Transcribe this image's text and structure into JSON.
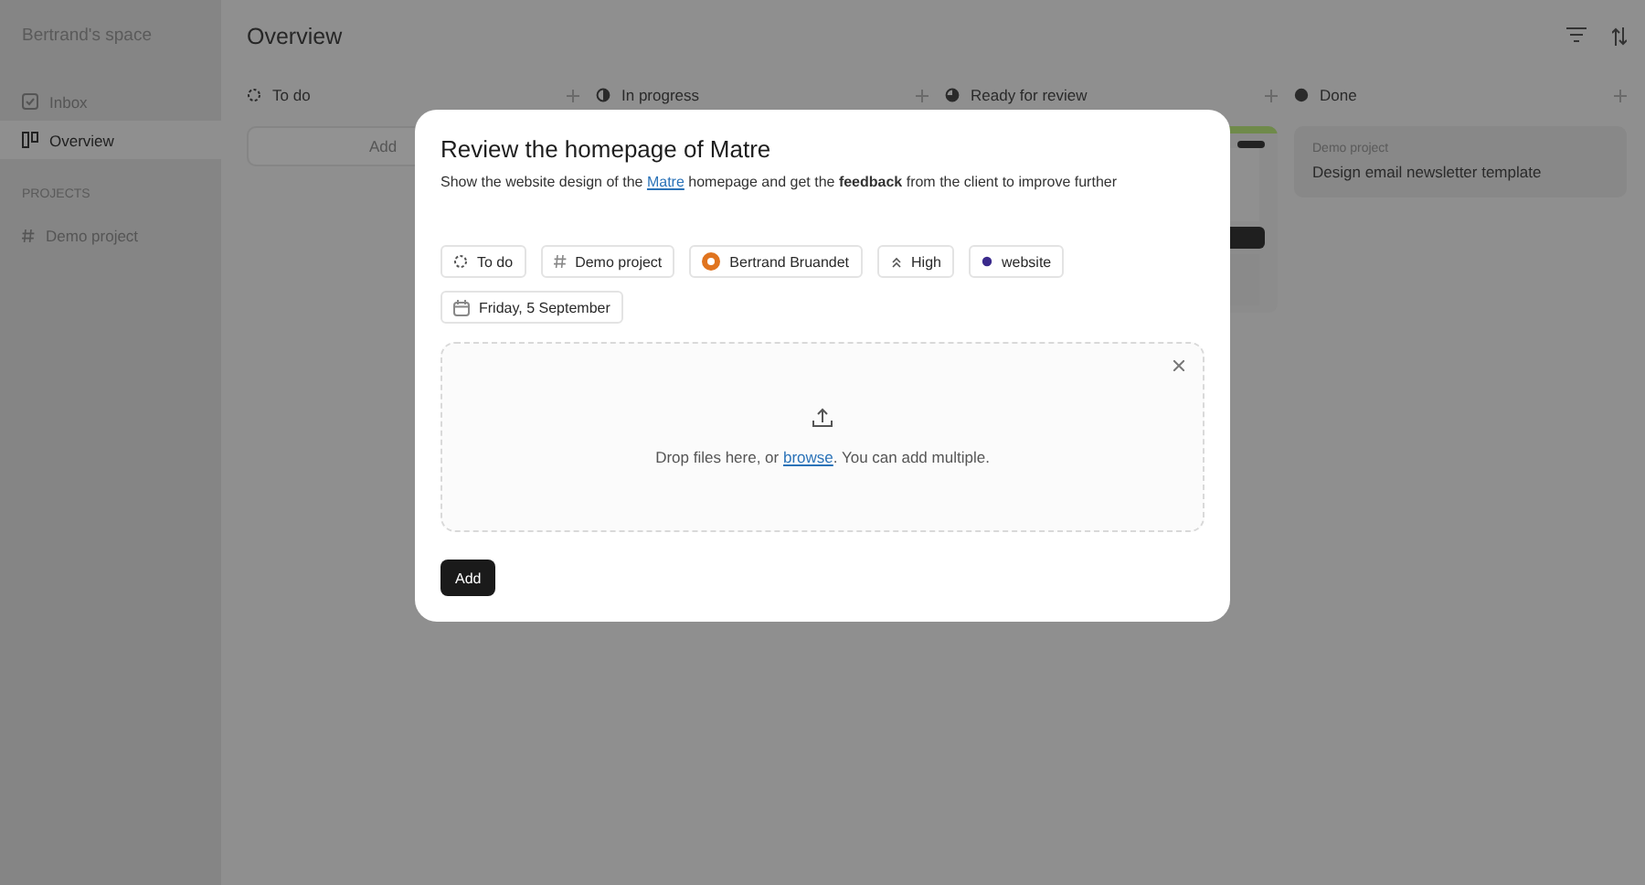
{
  "sidebar": {
    "workspace": "Bertrand's space",
    "items": [
      {
        "label": "Inbox",
        "selected": false
      },
      {
        "label": "Overview",
        "selected": true
      }
    ],
    "section": "PROJECTS",
    "projects": [
      {
        "label": "Demo project"
      }
    ]
  },
  "header": {
    "title": "Overview"
  },
  "columns": [
    {
      "title": "To do",
      "kind": "todo",
      "add_button": "Add"
    },
    {
      "title": "In progress",
      "kind": "progress"
    },
    {
      "title": "Ready for review",
      "kind": "review"
    },
    {
      "title": "Done",
      "kind": "done",
      "cards": [
        {
          "kind": "text",
          "project": "Demo project",
          "title": "Design email newsletter template"
        }
      ]
    }
  ],
  "modal": {
    "title": "Review the homepage of Matre",
    "description": {
      "before": "Show the website design of the ",
      "link": "Matre",
      "after": " homepage and get the **feedback** from the client to improve further"
    },
    "chips": [
      {
        "kind": "status",
        "label": "To do"
      },
      {
        "kind": "project",
        "label": "Demo project"
      },
      {
        "kind": "assignee",
        "label": "Bertrand Bruandet"
      },
      {
        "kind": "priority",
        "label": "High"
      },
      {
        "kind": "tag",
        "label": "website",
        "color": "#3b2a8c"
      },
      {
        "kind": "date",
        "label": "Friday, 5 September"
      }
    ],
    "dropzone": {
      "before": "Drop files here, or ",
      "link": "browse",
      "after": ". You can add multiple."
    },
    "submit": "Add"
  }
}
